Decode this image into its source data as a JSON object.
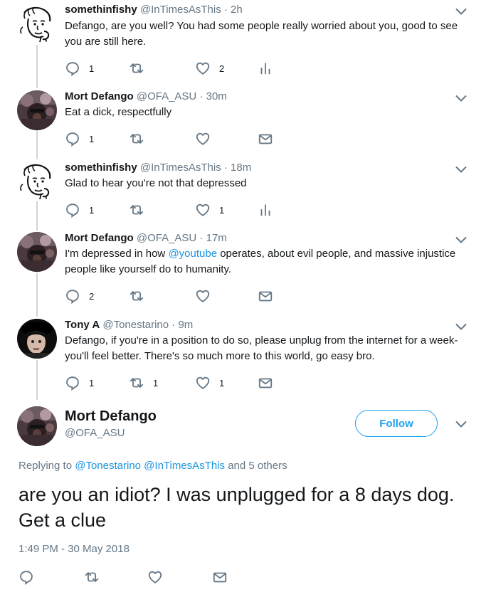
{
  "colors": {
    "link": "#1b95e0",
    "text": "#14171a",
    "muted": "#657786",
    "thread": "#ccd6dd",
    "follow": "#1da1f2"
  },
  "tweets": [
    {
      "name": "somethinfishy",
      "handle": "@InTimesAsThis",
      "time": "· 2h",
      "text": "Defango, are you well? You had some people really worried about you, good to see you are still here.",
      "replies": "1",
      "retweets": "",
      "likes": "2",
      "extra_icon": "analytics-icon"
    },
    {
      "name": "Mort Defango",
      "handle": "@OFA_ASU",
      "time": "· 30m",
      "text": "Eat a dick, respectfully",
      "replies": "1",
      "retweets": "",
      "likes": "",
      "extra_icon": "dm-icon"
    },
    {
      "name": "somethinfishy",
      "handle": "@InTimesAsThis",
      "time": "· 18m",
      "text": "Glad to hear you're not that depressed",
      "replies": "1",
      "retweets": "",
      "likes": "1",
      "extra_icon": "analytics-icon"
    },
    {
      "name": "Mort Defango",
      "handle": "@OFA_ASU",
      "time": "· 17m",
      "text_before": "I'm depressed in how ",
      "text_link": "@youtube",
      "text_after": " operates, about evil people, and massive injustice people like yourself do to humanity.",
      "replies": "2",
      "retweets": "",
      "likes": "",
      "extra_icon": "dm-icon"
    },
    {
      "name": "Tony A",
      "handle": "@Tonestarino",
      "time": "· 9m",
      "text": "Defango, if you're in a position to do so, please unplug from the internet for a week-you'll feel better. There's so much more to this world, go easy bro.",
      "replies": "1",
      "retweets": "1",
      "likes": "1",
      "extra_icon": "dm-icon"
    }
  ],
  "focus": {
    "name": "Mort Defango",
    "handle": "@OFA_ASU",
    "follow_label": "Follow",
    "replying_prefix": "Replying to ",
    "replying_user1": "@Tonestarino",
    "replying_user2": "@InTimesAsThis",
    "replying_suffix": " and 5 others",
    "text": "are you an idiot? I was unplugged for a 8 days dog. Get a clue",
    "timestamp": "1:49 PM - 30 May 2018"
  }
}
